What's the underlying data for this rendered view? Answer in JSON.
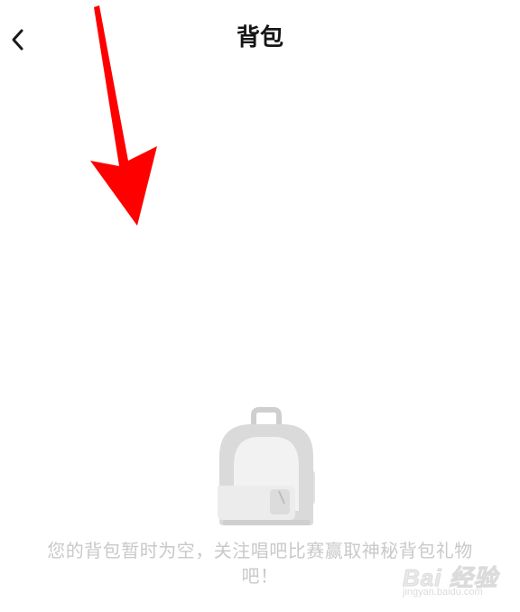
{
  "header": {
    "title": "背包",
    "back_icon": "chevron-left-icon"
  },
  "empty_state": {
    "illustration_icon": "backpack-icon",
    "message": "您的背包暂时为空，关注唱吧比赛赢取神秘背包礼物吧！"
  },
  "annotation": {
    "arrow_icon": "red-arrow-icon",
    "color": "#ff0000"
  },
  "watermark": {
    "logo_text": "Bai 经验",
    "url": "jingyan.baidu.com"
  },
  "colors": {
    "background": "#ffffff",
    "title": "#161616",
    "empty_text": "#c9c9c9",
    "backpack_gray": "#d4d4d4"
  }
}
